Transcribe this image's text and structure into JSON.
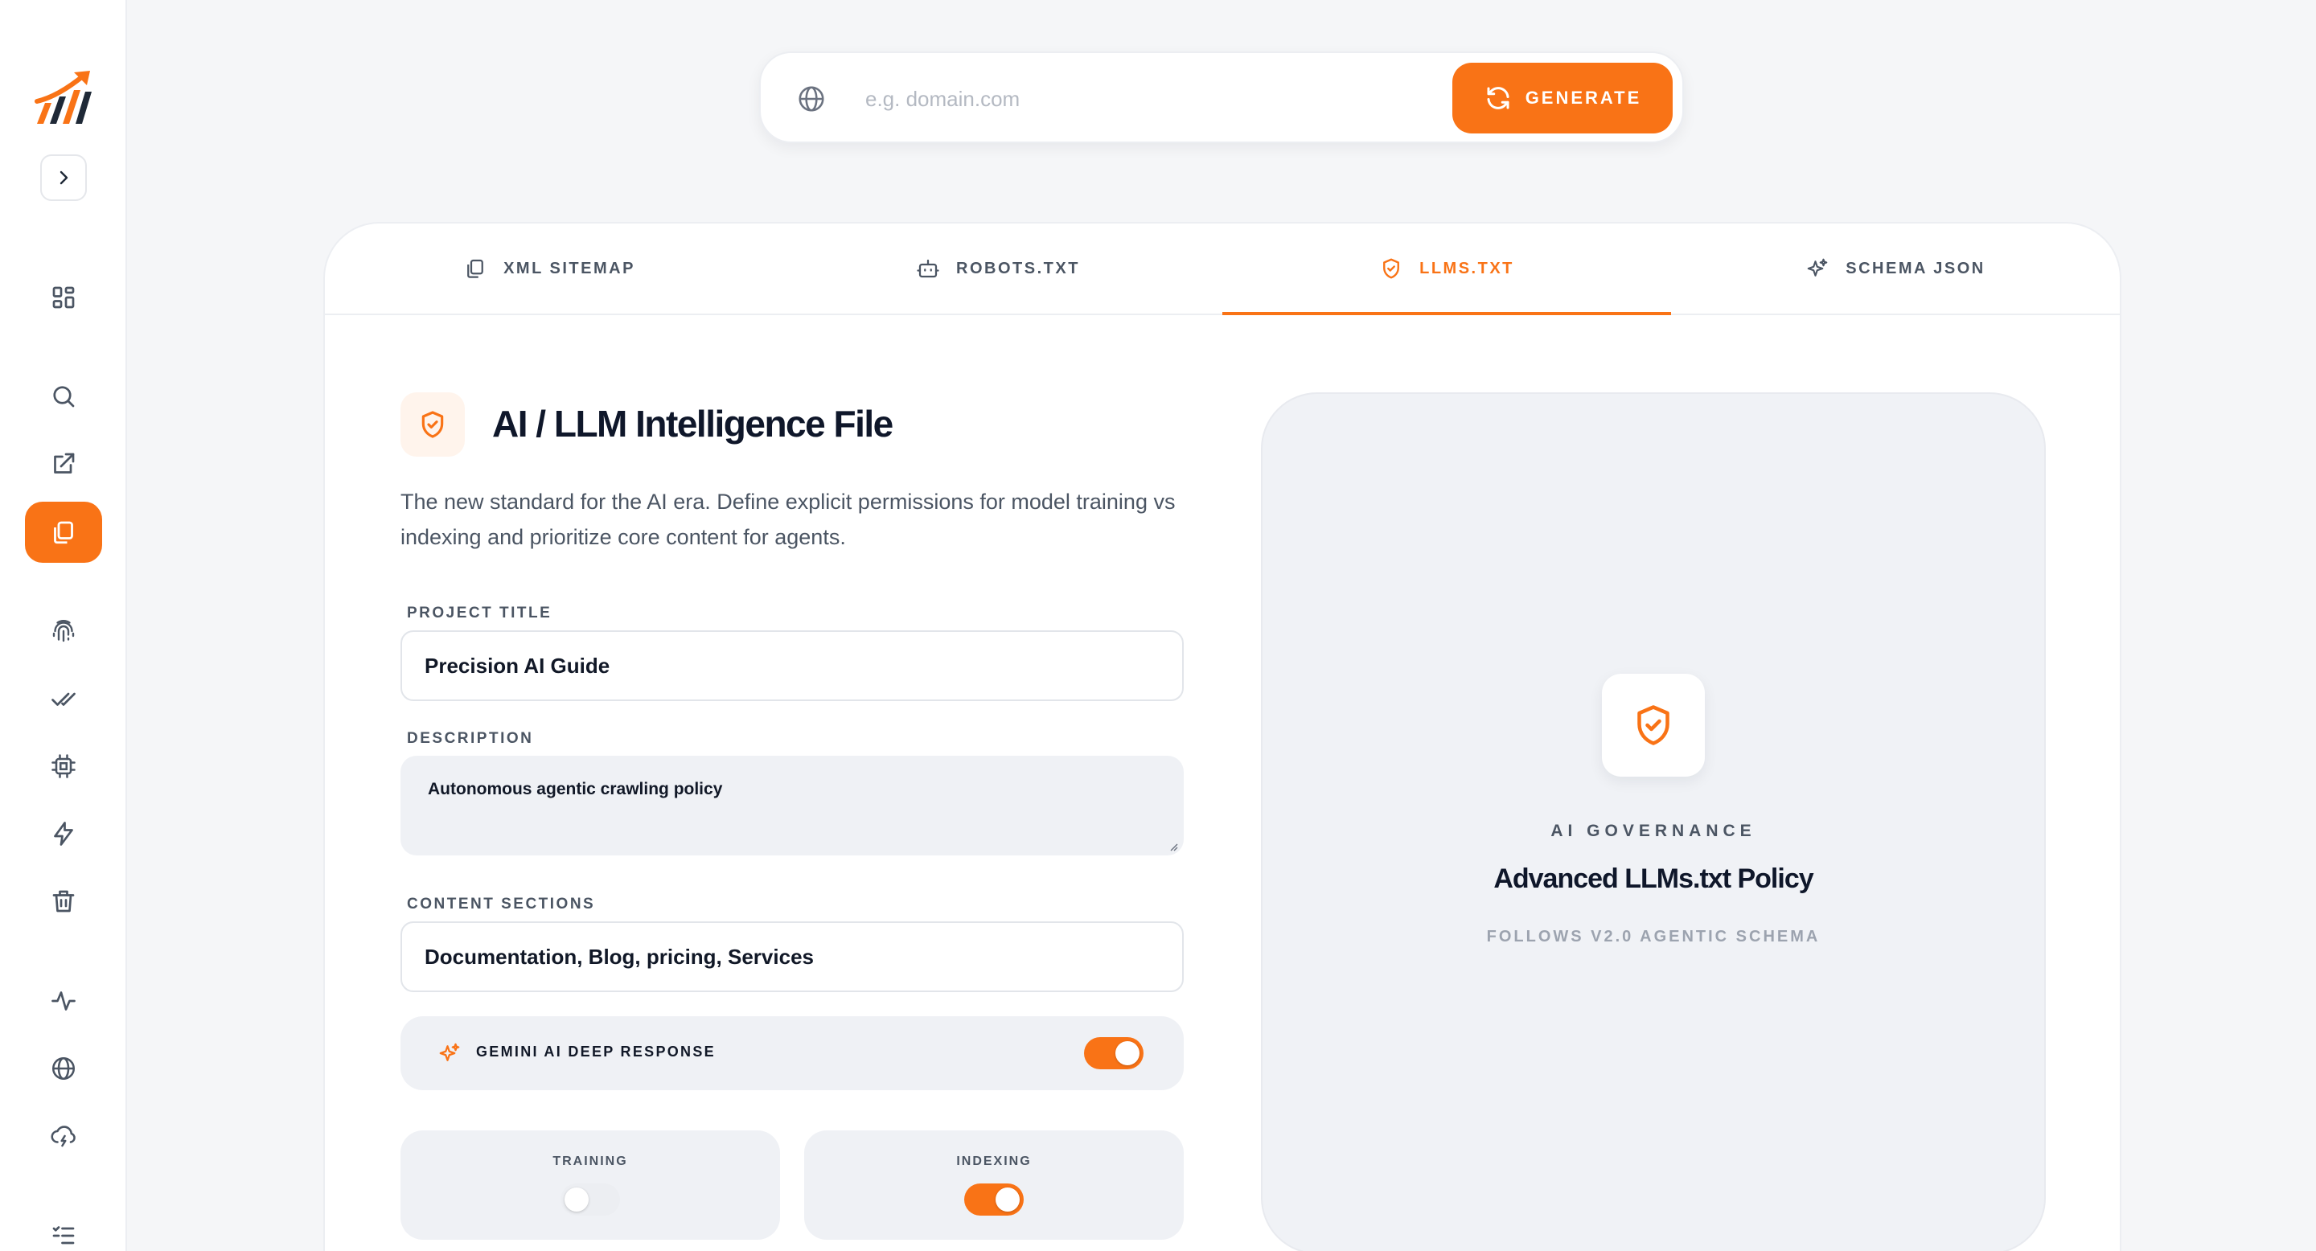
{
  "search": {
    "placeholder": "e.g. domain.com",
    "value": "",
    "generate_label": "GENERATE"
  },
  "tabs": [
    {
      "label": "XML SITEMAP",
      "icon": "copy-icon",
      "active": false
    },
    {
      "label": "ROBOTS.TXT",
      "icon": "robot-icon",
      "active": false
    },
    {
      "label": "LLMS.TXT",
      "icon": "shield-check-icon",
      "active": true
    },
    {
      "label": "SCHEMA JSON",
      "icon": "sparkles-icon",
      "active": false
    }
  ],
  "sidebar": {
    "icons": [
      "logo",
      "chevron-right-icon",
      "dashboard-grid-icon",
      "search-icon",
      "external-link-icon",
      "copy-icon",
      "fingerprint-icon",
      "double-check-icon",
      "cpu-chip-icon",
      "lightning-icon",
      "trash-icon",
      "activity-icon",
      "globe-icon",
      "cloud-lightning-icon",
      "list-check-icon"
    ],
    "active": "copy-icon"
  },
  "form": {
    "title": "AI / LLM Intelligence File",
    "intro": "The new standard for the AI era. Define explicit permissions for model training vs indexing and prioritize core content for agents.",
    "project_title_label": "PROJECT TITLE",
    "project_title_value": "Precision AI Guide",
    "description_label": "DESCRIPTION",
    "description_value": "Autonomous agentic crawling policy",
    "content_sections_label": "CONTENT SECTIONS",
    "content_sections_value": "Documentation, Blog, pricing, Services",
    "ai_toggle_label": "GEMINI AI DEEP RESPONSE",
    "ai_toggle_on": true,
    "training_label": "TRAINING",
    "training_on": false,
    "indexing_label": "INDEXING",
    "indexing_on": true
  },
  "preview": {
    "kicker": "AI GOVERNANCE",
    "title": "Advanced LLMs.txt Policy",
    "subtitle": "FOLLOWS V2.0 AGENTIC SCHEMA"
  },
  "colors": {
    "accent": "#f97316",
    "background": "#f5f6f8",
    "card": "#ffffff",
    "muted_panel": "#eff1f5"
  }
}
